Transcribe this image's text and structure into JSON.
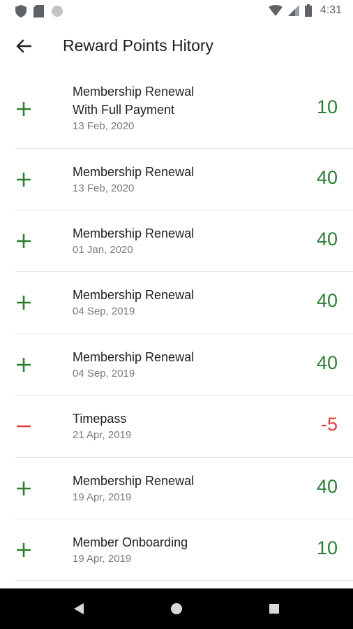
{
  "status_bar": {
    "icons_left": [
      "shield-icon",
      "sd-card-icon",
      "circle-icon"
    ],
    "icons_right": [
      "wifi-icon",
      "signal-icon",
      "battery-icon"
    ],
    "time": "4:31"
  },
  "app_bar": {
    "back_icon": "arrow-left-icon",
    "title": "Reward Points Hitory"
  },
  "colors": {
    "positive": "#2e7d32",
    "negative": "#e53935"
  },
  "history": [
    {
      "sign": "plus",
      "title_line1": "Membership Renewal",
      "title_line2": "With Full Payment",
      "date": "13 Feb, 2020",
      "points": "10"
    },
    {
      "sign": "plus",
      "title_line1": "Membership Renewal",
      "title_line2": "",
      "date": "13 Feb, 2020",
      "points": "40"
    },
    {
      "sign": "plus",
      "title_line1": "Membership Renewal",
      "title_line2": "",
      "date": "01 Jan, 2020",
      "points": "40"
    },
    {
      "sign": "plus",
      "title_line1": "Membership Renewal",
      "title_line2": "",
      "date": "04 Sep, 2019",
      "points": "40"
    },
    {
      "sign": "plus",
      "title_line1": "Membership Renewal",
      "title_line2": "",
      "date": "04 Sep, 2019",
      "points": "40"
    },
    {
      "sign": "minus",
      "title_line1": "Timepass",
      "title_line2": "",
      "date": "21 Apr, 2019",
      "points": "-5"
    },
    {
      "sign": "plus",
      "title_line1": "Membership Renewal",
      "title_line2": "",
      "date": "19 Apr, 2019",
      "points": "40"
    },
    {
      "sign": "plus",
      "title_line1": "Member Onboarding",
      "title_line2": "",
      "date": "19 Apr, 2019",
      "points": "10"
    }
  ],
  "nav_bar": {
    "buttons": [
      "back-triangle-icon",
      "home-circle-icon",
      "recents-square-icon"
    ]
  }
}
